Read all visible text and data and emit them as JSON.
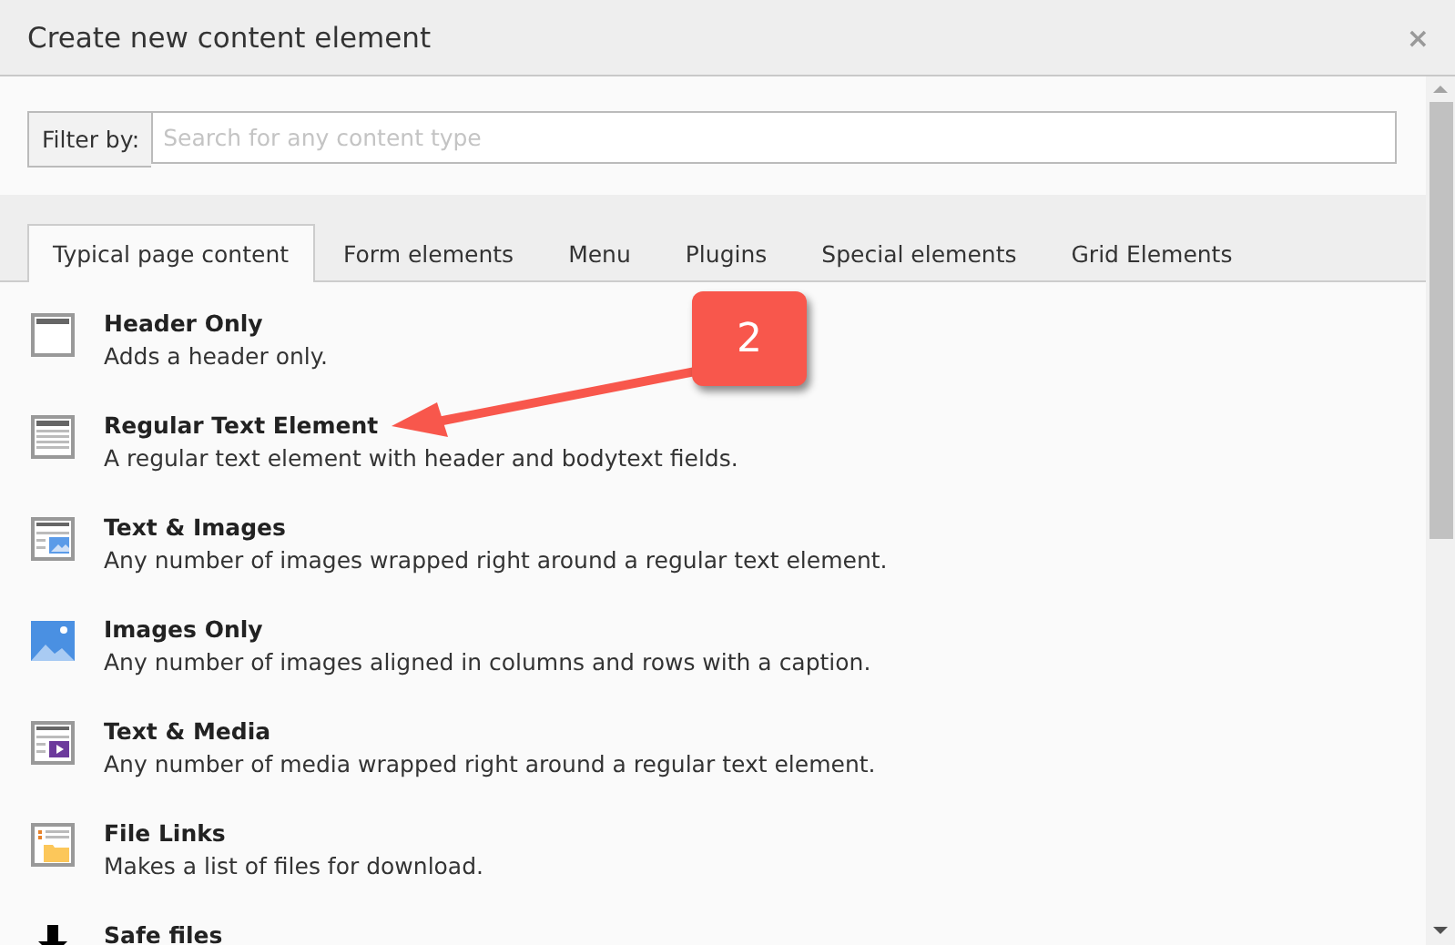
{
  "dialog": {
    "title": "Create new content element",
    "close": "×"
  },
  "filter": {
    "label": "Filter by:",
    "placeholder": "Search for any content type"
  },
  "tabs": [
    {
      "label": "Typical page content",
      "selected": true
    },
    {
      "label": "Form elements",
      "selected": false
    },
    {
      "label": "Menu",
      "selected": false
    },
    {
      "label": "Plugins",
      "selected": false
    },
    {
      "label": "Special elements",
      "selected": false
    },
    {
      "label": "Grid Elements",
      "selected": false
    }
  ],
  "items": [
    {
      "kind": "header",
      "title": "Header Only",
      "description": "Adds a header only."
    },
    {
      "kind": "text",
      "title": "Regular Text Element",
      "description": "A regular text element with header and bodytext fields."
    },
    {
      "kind": "textpic",
      "title": "Text & Images",
      "description": "Any number of images wrapped right around a regular text element."
    },
    {
      "kind": "image",
      "title": "Images Only",
      "description": "Any number of images aligned in columns and rows with a caption."
    },
    {
      "kind": "textmedia",
      "title": "Text & Media",
      "description": "Any number of media wrapped right around a regular text element."
    },
    {
      "kind": "filelinks",
      "title": "File Links",
      "description": "Makes a list of files for download."
    },
    {
      "kind": "download",
      "title": "Safe files"
    }
  ],
  "callout": {
    "label": "2"
  }
}
